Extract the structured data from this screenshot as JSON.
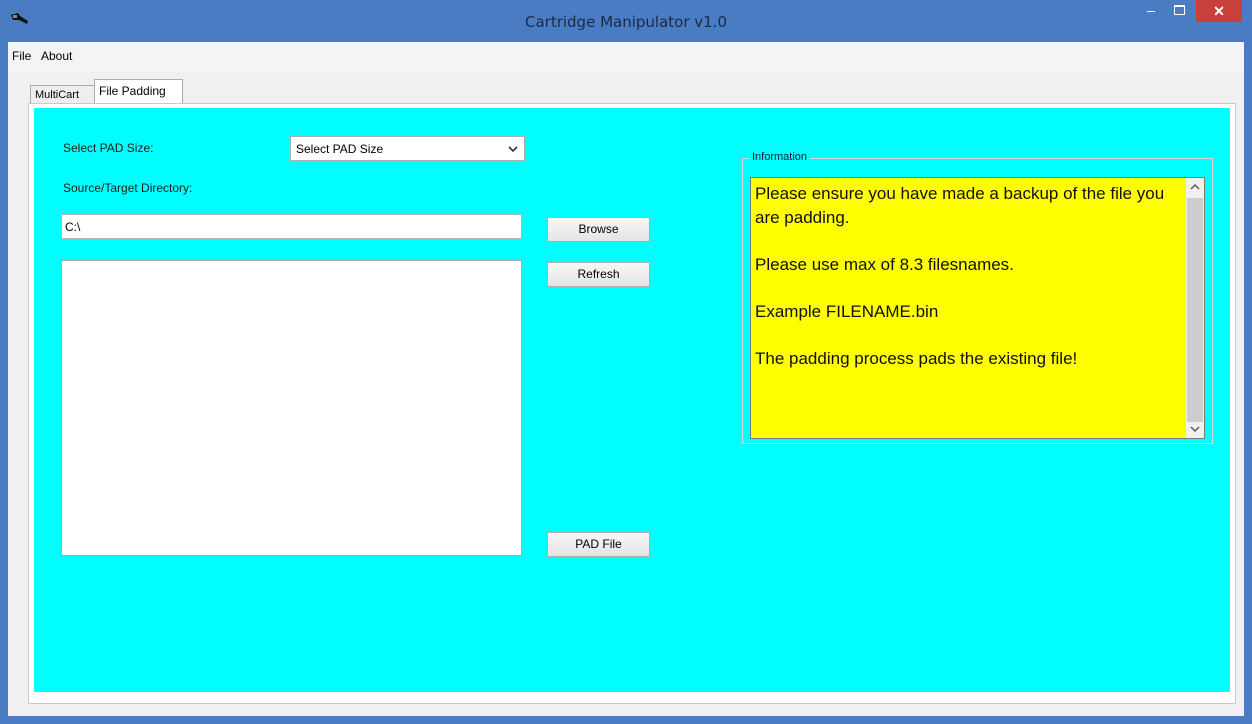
{
  "window": {
    "title": "Cartridge Manipulator v1.0",
    "minimize_symbol": "–",
    "close_symbol": "✕"
  },
  "menu": {
    "items": [
      {
        "label": "File"
      },
      {
        "label": "About"
      }
    ]
  },
  "tabs": [
    {
      "label": "MultiCart"
    },
    {
      "label": "File Padding",
      "active": true
    }
  ],
  "file_padding": {
    "pad_size_label": "Select PAD Size:",
    "pad_size_selected": "Select PAD Size",
    "directory_label": "Source/Target Directory:",
    "directory_value": "C:\\",
    "browse_label": "Browse",
    "refresh_label": "Refresh",
    "pad_file_label": "PAD File",
    "file_list": []
  },
  "information": {
    "legend": "Information",
    "lines": [
      "Please ensure you have made a backup of the file you are padding.",
      "Please use max of 8.3 filesnames.",
      "Example FILENAME.bin",
      "The padding process pads the existing file!"
    ]
  },
  "colors": {
    "panel_background": "#00ffff",
    "info_background": "#ffff00",
    "titlebar": "#4a7cc4",
    "close_button": "#c7403a"
  },
  "icons": {
    "app": "app-icon",
    "dropdown": "chevron-down-icon",
    "scroll_up": "chevron-up-icon",
    "scroll_down": "chevron-down-icon"
  }
}
